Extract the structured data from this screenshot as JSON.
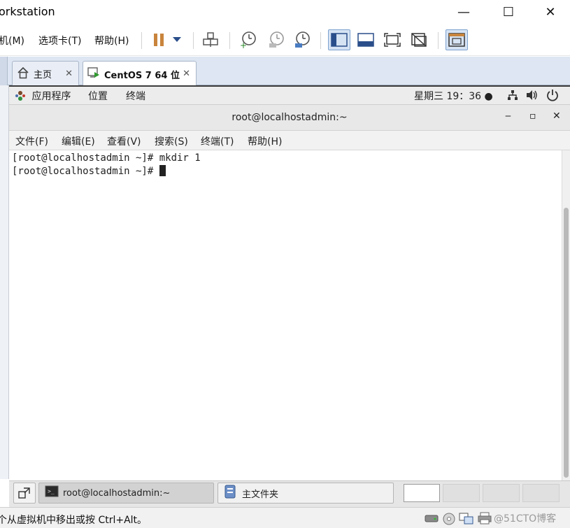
{
  "app": {
    "title": "orkstation",
    "window_controls": {
      "minimize": "—",
      "maximize": "☐",
      "close": "✕"
    }
  },
  "menu": {
    "items": [
      "机(M)",
      "选项卡(T)",
      "帮助(H)"
    ]
  },
  "toolbar": {
    "icons": [
      "pause-icon",
      "dropdown-arrow-icon",
      "send-keys-icon",
      "snapshot-take-icon",
      "snapshot-revert-icon",
      "snapshot-manager-icon",
      "view-console-icon",
      "view-fit-icon",
      "full-screen-icon",
      "unity-icon",
      "thumbnail-view-icon"
    ]
  },
  "tabs": [
    {
      "label": "主页",
      "icon": "home-icon",
      "close": "✕"
    },
    {
      "label": "CentOS 7 64 位",
      "icon": "vm-running-icon",
      "close": "✕",
      "active": true
    }
  ],
  "gnome_top": {
    "applications": "应用程序",
    "places": "位置",
    "terminal": "终端",
    "clock": "星期三 19：36 ●"
  },
  "terminal": {
    "title": "root@localhostadmin:~",
    "controls": {
      "minimize": "‒",
      "maximize": "▫",
      "close": "✕"
    },
    "menu": [
      "文件(F)",
      "编辑(E)",
      "查看(V)",
      "搜索(S)",
      "终端(T)",
      "帮助(H)"
    ],
    "lines": [
      "[root@localhostadmin ~]# mkdir 1",
      "[root@localhostadmin ~]# "
    ]
  },
  "taskbar": {
    "items": [
      {
        "label": "root@localhostadmin:~",
        "icon": "terminal-icon"
      },
      {
        "label": "主文件夹",
        "icon": "file-manager-icon"
      }
    ]
  },
  "statusbar": {
    "message": "个从虚拟机中移出或按 Ctrl+Alt。",
    "watermark": "@51CTO博客"
  },
  "colors": {
    "accent": "#4a7cc1",
    "tab_strip": "#dde6f2",
    "pause_orange": "#c8843c"
  }
}
